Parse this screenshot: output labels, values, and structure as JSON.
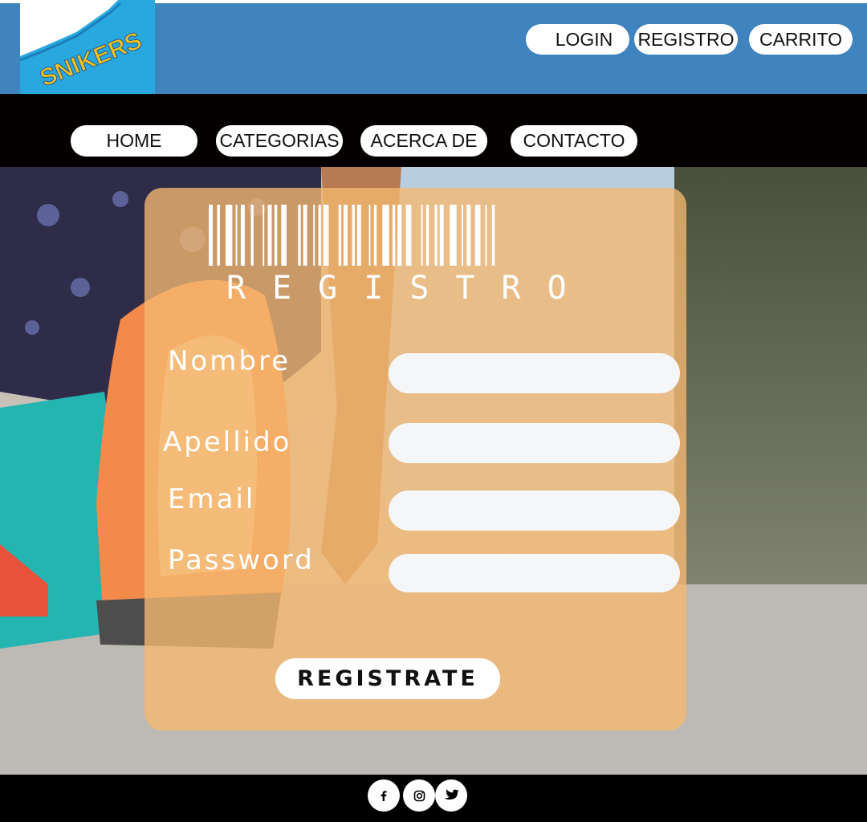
{
  "header": {
    "logo_text": "SNIKERS",
    "links": {
      "login": "LOGIN",
      "registro": "REGISTRO",
      "carrito": "CARRITO"
    }
  },
  "nav": {
    "home": "HOME",
    "categorias": "CATEGORIAS",
    "acerca": "ACERCA DE",
    "contacto": "CONTACTO"
  },
  "form": {
    "title": "REGISTRO",
    "fields": {
      "nombre": {
        "label": "Nombre",
        "value": ""
      },
      "apellido": {
        "label": "Apellido",
        "value": ""
      },
      "email": {
        "label": "Email",
        "value": ""
      },
      "password": {
        "label": "Password",
        "value": ""
      }
    },
    "submit": "REGISTRATE"
  },
  "footer": {
    "social": [
      "facebook-icon",
      "instagram-icon",
      "twitter-icon"
    ]
  },
  "colors": {
    "header_bg": "#3f83bf",
    "nav_bg": "#040000",
    "card_bg": "#f5b870",
    "footer_bg": "#000000",
    "logo_yellow": "#f2c21b",
    "logo_blue": "#29a8e0"
  }
}
